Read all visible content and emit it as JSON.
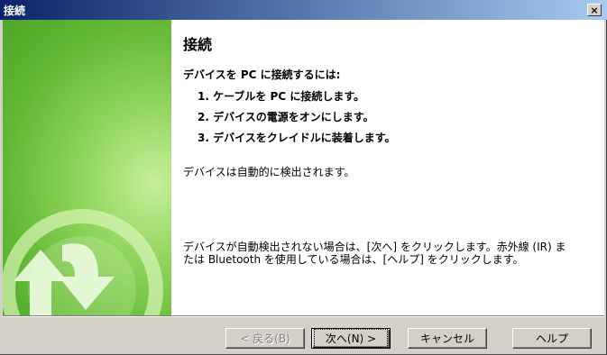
{
  "window": {
    "title": "接続",
    "close_label": "×"
  },
  "content": {
    "heading": "接続",
    "intro": "デバイスを PC に接続するには:",
    "steps": [
      "1. ケーブルを PC に接続します。",
      "2. デバイスの電源をオンにします。",
      "3. デバイスをクレイドルに装着します。"
    ],
    "auto_detect": "デバイスは自動的に検出されます。",
    "note_line1": "デバイスが自動検出されない場合は、[次へ] をクリックします。赤外線 (IR) ま",
    "note_line2": "たは Bluetooth を使用している場合は、[ヘルプ] をクリックします。"
  },
  "buttons": {
    "back": "< 戻る(B)",
    "next": "次へ(N) >",
    "cancel": "キャンセル",
    "help": "ヘルプ"
  },
  "colors": {
    "title_bar": "#0a246a",
    "side_panel": "#61b833",
    "dialog_face": "#d4d0c8"
  },
  "icons": {
    "side_panel_icon": "sync-arrows-icon",
    "close": "close-icon"
  }
}
